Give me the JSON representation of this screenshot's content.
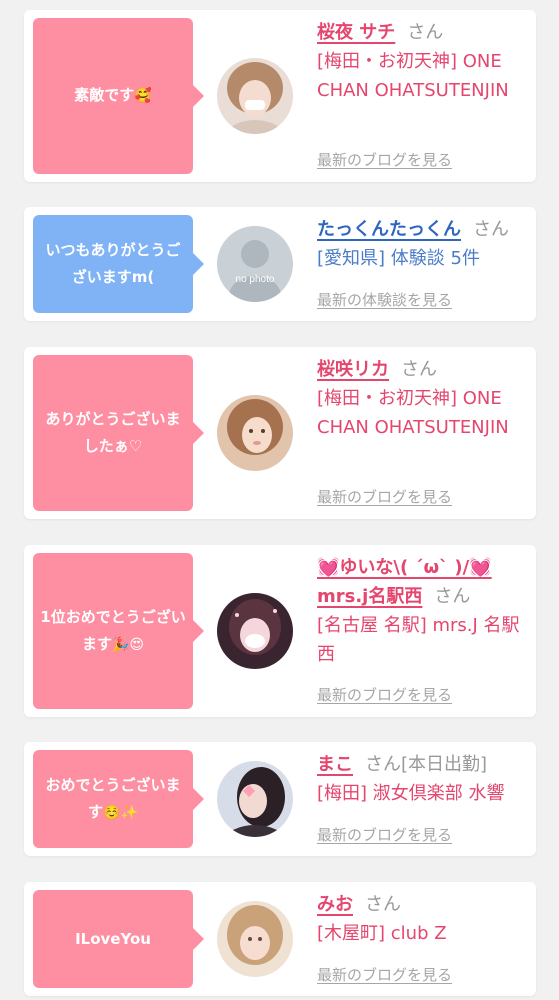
{
  "cards": [
    {
      "message": "素敵です",
      "message_emoji": "🥰",
      "name": "桜夜 サチ",
      "honorific": "さん",
      "shop": "[梅田・お初天神] ONE CHAN OHATSUTENJIN",
      "more": "最新のブログを見る",
      "avatar": "girl-photo-avatar"
    },
    {
      "message": "いつもありがとうございますm(",
      "message_emoji": "",
      "name": "たっくんたっくん",
      "honorific": "さん",
      "shop": "[愛知県] 体験談 5件",
      "more": "最新の体験談を見る",
      "avatar": "no-photo-avatar",
      "avatar_text": "no photo"
    },
    {
      "message": "ありがとうございましたぁ♡",
      "message_emoji": "",
      "name": "桜咲リカ",
      "honorific": "さん",
      "shop": "[梅田・お初天神] ONE CHAN OHATSUTENJIN",
      "more": "最新のブログを見る",
      "avatar": "girl-photo-avatar"
    },
    {
      "message": "1位おめでとうございます",
      "message_emoji": "🎉😍",
      "name": "💓ゆいな\\( ´ω` )/💓mrs.j名駅西",
      "honorific": "さん",
      "shop": "[名古屋 名駅] mrs.J 名駅西",
      "more": "最新のブログを見る",
      "avatar": "girl-photo-avatar"
    },
    {
      "message": "おめでとうございます",
      "message_emoji": "☺️✨",
      "name": "まこ",
      "honorific": "さん[本日出勤]",
      "shop": "[梅田] 淑女倶楽部 水響",
      "more": "最新のブログを見る",
      "avatar": "girl-photo-avatar"
    },
    {
      "message": "ILoveYou",
      "message_emoji": "",
      "name": "みお",
      "honorific": "さん",
      "shop": "[木屋町] club Z",
      "more": "最新のブログを見る",
      "avatar": "girl-photo-avatar"
    }
  ],
  "colors": {
    "pink_bubble": "#fe8fa3",
    "blue_bubble": "#7fb3f5",
    "name_pink": "#e5466e",
    "name_blue": "#2f66c0",
    "muted": "#a6a6a6",
    "background": "#f1f1f1"
  }
}
